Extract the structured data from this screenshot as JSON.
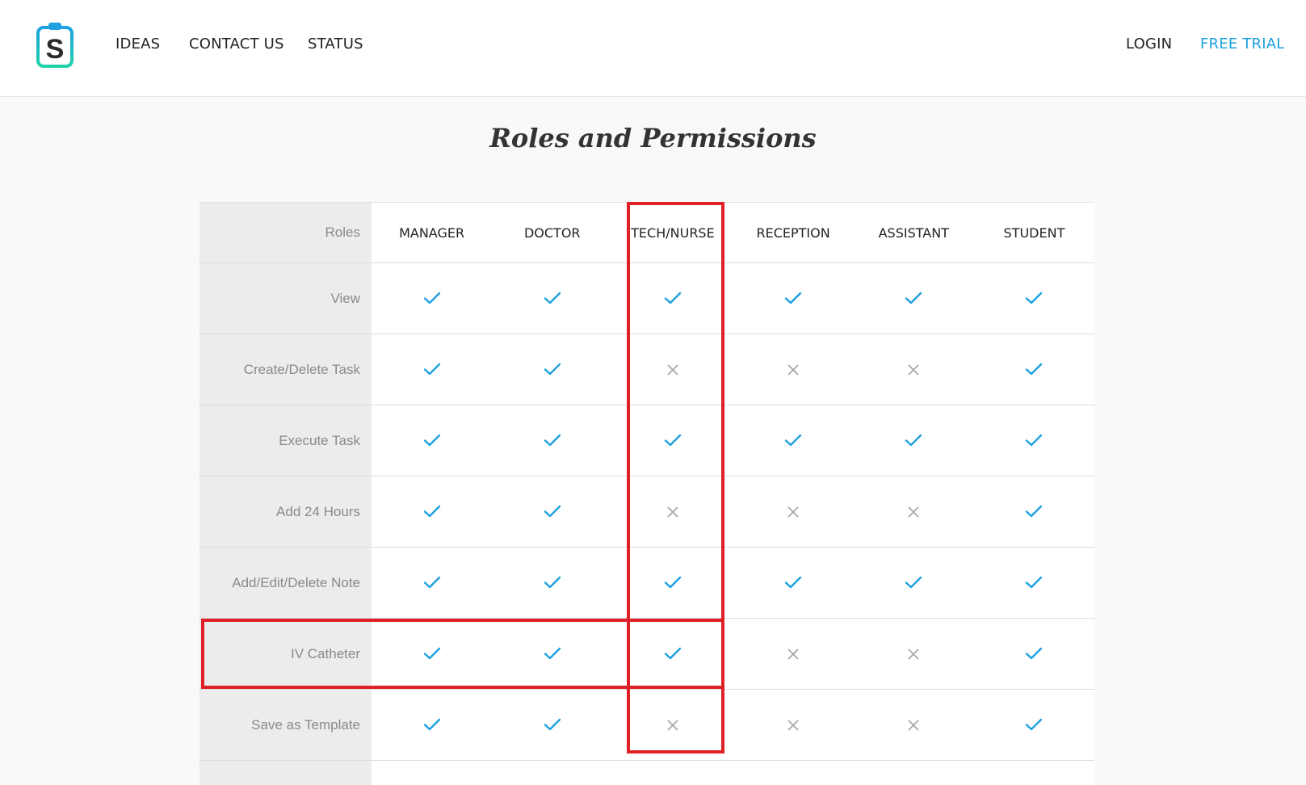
{
  "nav": {
    "ideas": "IDEAS",
    "contact": "CONTACT US",
    "status": "STATUS",
    "login": "LOGIN",
    "free_trial": "FREE TRIAL"
  },
  "logo_letter": "S",
  "page_title": "Roles and Permissions",
  "table": {
    "header_label": "Roles",
    "columns": [
      "MANAGER",
      "DOCTOR",
      "TECH/NURSE",
      "RECEPTION",
      "ASSISTANT",
      "STUDENT"
    ],
    "rows": [
      {
        "label": "View",
        "values": [
          true,
          true,
          true,
          true,
          true,
          true
        ]
      },
      {
        "label": "Create/Delete Task",
        "values": [
          true,
          true,
          false,
          false,
          false,
          true
        ]
      },
      {
        "label": "Execute Task",
        "values": [
          true,
          true,
          true,
          true,
          true,
          true
        ]
      },
      {
        "label": "Add 24 Hours",
        "values": [
          true,
          true,
          false,
          false,
          false,
          true
        ]
      },
      {
        "label": "Add/Edit/Delete Note",
        "values": [
          true,
          true,
          true,
          true,
          true,
          true
        ]
      },
      {
        "label": "IV Catheter",
        "values": [
          true,
          true,
          true,
          false,
          false,
          true
        ]
      },
      {
        "label": "Save as Template",
        "values": [
          true,
          true,
          false,
          false,
          false,
          true
        ]
      }
    ]
  },
  "colors": {
    "accent": "#1da1e0",
    "check": "#1da1e0",
    "cross": "#a8a8a8",
    "highlight": "#e02027"
  },
  "icons": {
    "logo": "clipboard-s-icon",
    "allowed": "check-icon",
    "denied": "cross-icon"
  }
}
